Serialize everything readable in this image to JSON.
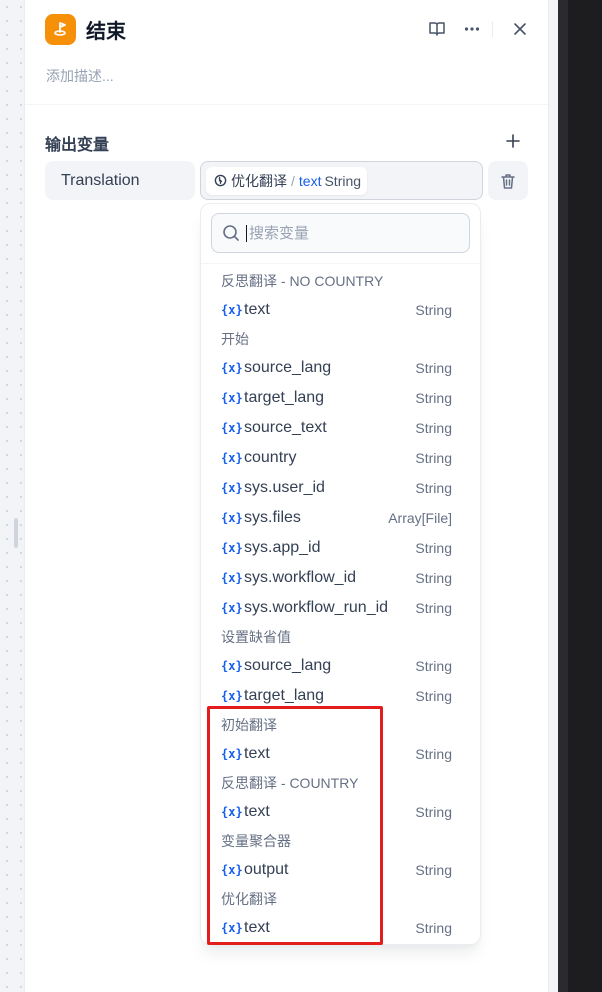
{
  "node": {
    "title": "结束",
    "description_placeholder": "添加描述..."
  },
  "output": {
    "section_title": "输出变量",
    "var_name": "Translation",
    "selected": {
      "node": "优化翻译",
      "separator": "/",
      "var": "text",
      "type": "String"
    }
  },
  "dropdown": {
    "search_placeholder": "搜索变量",
    "groups": [
      {
        "title": "反思翻译 - NO COUNTRY",
        "items": [
          {
            "name": "text",
            "type": "String"
          }
        ]
      },
      {
        "title": "开始",
        "items": [
          {
            "name": "source_lang",
            "type": "String"
          },
          {
            "name": "target_lang",
            "type": "String"
          },
          {
            "name": "source_text",
            "type": "String"
          },
          {
            "name": "country",
            "type": "String"
          },
          {
            "name": "sys.user_id",
            "type": "String"
          },
          {
            "name": "sys.files",
            "type": "Array[File]"
          },
          {
            "name": "sys.app_id",
            "type": "String"
          },
          {
            "name": "sys.workflow_id",
            "type": "String"
          },
          {
            "name": "sys.workflow_run_id",
            "type": "String"
          }
        ]
      },
      {
        "title": "设置缺省值",
        "items": [
          {
            "name": "source_lang",
            "type": "String"
          },
          {
            "name": "target_lang",
            "type": "String"
          }
        ]
      },
      {
        "title": "初始翻译",
        "items": [
          {
            "name": "text",
            "type": "String"
          }
        ]
      },
      {
        "title": "反思翻译 - COUNTRY",
        "items": [
          {
            "name": "text",
            "type": "String"
          }
        ]
      },
      {
        "title": "变量聚合器",
        "items": [
          {
            "name": "output",
            "type": "String"
          }
        ]
      },
      {
        "title": "优化翻译",
        "items": [
          {
            "name": "text",
            "type": "String"
          }
        ]
      }
    ]
  },
  "colors": {
    "accent": "#155eef",
    "node_icon": "#f79009",
    "highlight": "#e31d1c"
  }
}
